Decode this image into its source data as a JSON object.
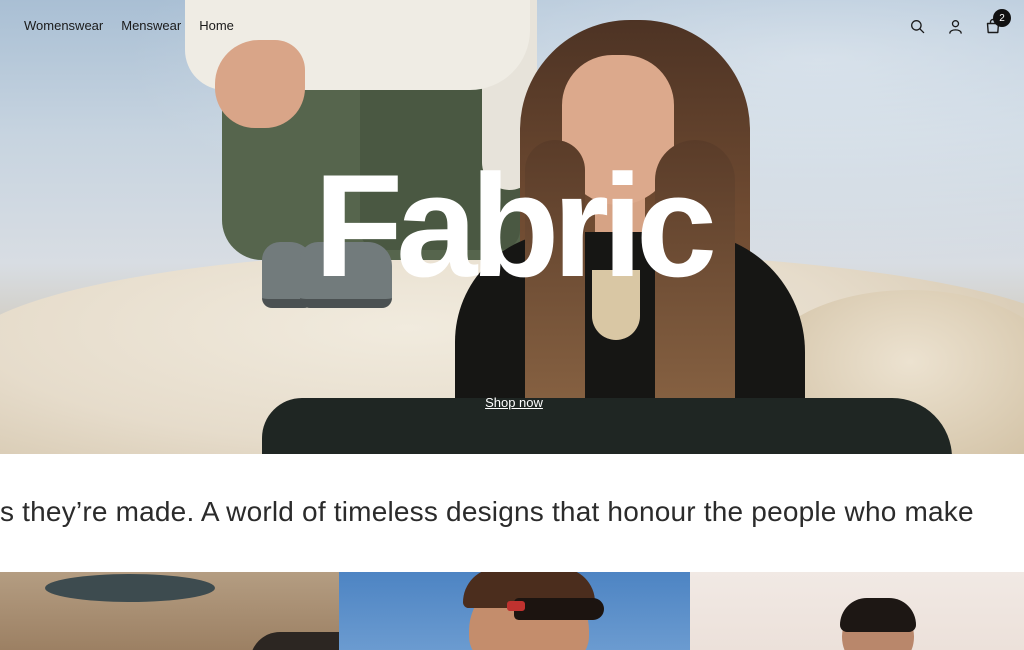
{
  "header": {
    "nav": [
      {
        "label": "Womenswear"
      },
      {
        "label": "Menswear"
      },
      {
        "label": "Home"
      }
    ],
    "icons": {
      "search": "search-icon",
      "account": "account-icon",
      "cart": "cart-icon"
    },
    "cart_count": "2"
  },
  "hero": {
    "title": "Fabric",
    "cta": "Shop now"
  },
  "marquee": {
    "text": "s they’re made.  A world of timeless designs that honour the people who make"
  },
  "colors": {
    "text": "#1a1a1a",
    "hero_title": "#ffffff",
    "badge": "#111111"
  }
}
